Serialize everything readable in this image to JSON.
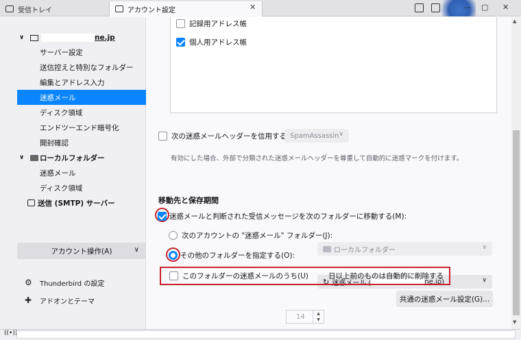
{
  "tabs": [
    {
      "label": "受信トレイ",
      "icon": "envelope-icon"
    },
    {
      "label": "アカウント設定",
      "icon": "settings-tab-icon"
    }
  ],
  "sidebar": {
    "account_suffix": "ne.jp",
    "account_items": [
      "サーバー設定",
      "送信控えと特別なフォルダー",
      "編集とアドレス入力",
      "迷惑メール",
      "ディスク領域",
      "エンドツーエンド暗号化",
      "開封確認"
    ],
    "selected_index": 3,
    "local_folders": "ローカルフォルダー",
    "local_items": [
      "迷惑メール",
      "ディスク領域"
    ],
    "smtp": "送信 (SMTP) サーバー",
    "account_actions": "アカウント操作(A)",
    "thunderbird_settings": "Thunderbird の設定",
    "addons": "アドオンとテーマ"
  },
  "main": {
    "address_books": [
      {
        "label": "記録用アドレス帳",
        "checked": false
      },
      {
        "label": "個人用アドレス帳",
        "checked": true
      }
    ],
    "trust_header_label": "次の迷惑メールヘッダーを信用する(T):",
    "trust_header_value": "SpamAssassin",
    "trust_header_desc": "有効にした場合、外部で分類された迷惑メールヘッダーを尊重して自動的に迷惑マークを付けます。",
    "section_title": "移動先と保存期間",
    "move_label": "迷惑メールと判断された受信メッセージを次のフォルダーに移動する(M):",
    "radio_account_label": "次のアカウントの \"迷惑メール\" フォルダー(J):",
    "radio_account_value": "ローカルフォルダー",
    "radio_other_label": "その他のフォルダーを指定する(O):",
    "radio_other_value_prefix": "迷惑メール (",
    "radio_other_value_suffix": "ne.jp)",
    "delete_label_a": "このフォルダーの迷惑メールのうち(U)",
    "delete_days": "14",
    "delete_label_b": "日以上前のものは自動的に削除する",
    "junk_settings_button": "共通の迷惑メール設定(G)..."
  }
}
